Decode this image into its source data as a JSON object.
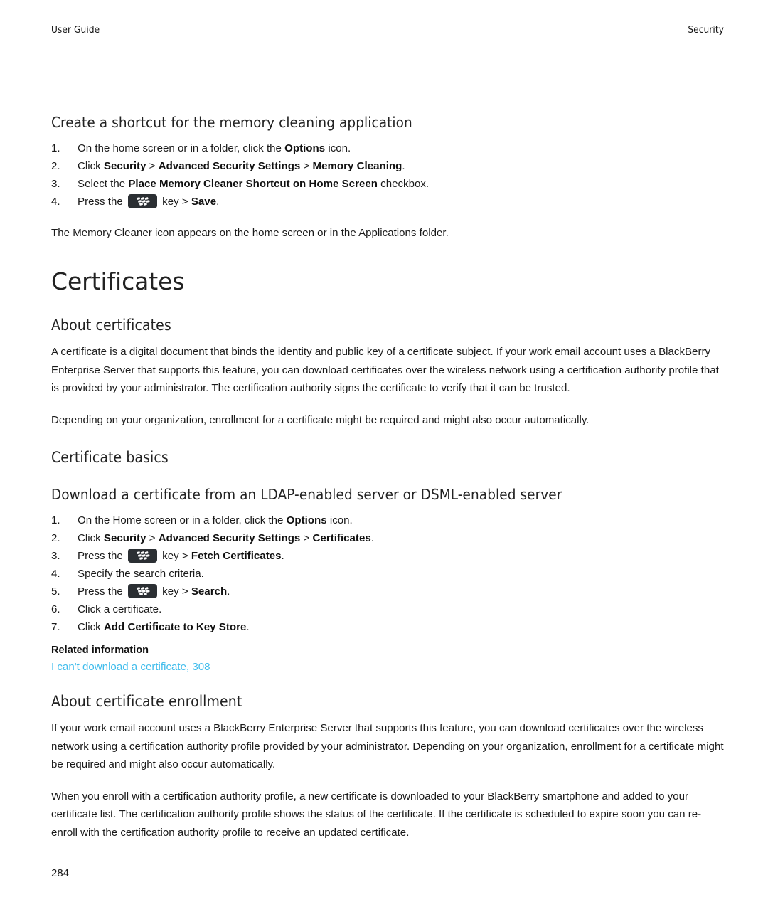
{
  "header": {
    "left": "User Guide",
    "right": "Security"
  },
  "colors": {
    "text": "#1a1a1a",
    "heading": "#222222",
    "link": "#41bdec",
    "menu_key_bg": "#2b2f33"
  },
  "icons": {
    "menu_key": "blackberry-menu-key-icon"
  },
  "task_memory_shortcut": {
    "heading": "Create a shortcut for the memory cleaning application",
    "steps": [
      {
        "parts": [
          {
            "t": "On the home screen or in a folder, click the ",
            "b": false
          },
          {
            "t": "Options",
            "b": true
          },
          {
            "t": " icon.",
            "b": false
          }
        ]
      },
      {
        "parts": [
          {
            "t": "Click ",
            "b": false
          },
          {
            "t": "Security",
            "b": true
          },
          {
            "t": " > ",
            "b": false
          },
          {
            "t": "Advanced Security Settings",
            "b": true
          },
          {
            "t": " > ",
            "b": false
          },
          {
            "t": "Memory Cleaning",
            "b": true
          },
          {
            "t": ".",
            "b": false
          }
        ]
      },
      {
        "parts": [
          {
            "t": "Select the ",
            "b": false
          },
          {
            "t": "Place Memory Cleaner Shortcut on Home Screen",
            "b": true
          },
          {
            "t": " checkbox.",
            "b": false
          }
        ]
      },
      {
        "parts": [
          {
            "t": "Press the ",
            "b": false
          },
          {
            "icon": "menu-key"
          },
          {
            "t": " key > ",
            "b": false
          },
          {
            "t": "Save",
            "b": true
          },
          {
            "t": ".",
            "b": false
          }
        ]
      }
    ],
    "result": "The Memory Cleaner icon appears on the home screen or in the Applications folder."
  },
  "chapter": {
    "title": "Certificates"
  },
  "about_certificates": {
    "heading": "About certificates",
    "paragraphs": [
      "A certificate is a digital document that binds the identity and public key of a certificate subject. If your work email account uses a BlackBerry Enterprise Server that supports this feature, you can download certificates over the wireless network using a certification authority profile that is provided by your administrator. The certification authority signs the certificate to verify that it can be trusted.",
      "Depending on your organization, enrollment for a certificate might be required and might also occur automatically."
    ]
  },
  "certificate_basics": {
    "heading": "Certificate basics"
  },
  "task_download_certificate": {
    "heading": "Download a certificate from an LDAP-enabled server or DSML-enabled server",
    "steps": [
      {
        "parts": [
          {
            "t": "On the Home screen or in a folder, click the ",
            "b": false
          },
          {
            "t": "Options",
            "b": true
          },
          {
            "t": " icon.",
            "b": false
          }
        ]
      },
      {
        "parts": [
          {
            "t": "Click ",
            "b": false
          },
          {
            "t": "Security",
            "b": true
          },
          {
            "t": " > ",
            "b": false
          },
          {
            "t": "Advanced Security Settings",
            "b": true
          },
          {
            "t": " > ",
            "b": false
          },
          {
            "t": "Certificates",
            "b": true
          },
          {
            "t": ".",
            "b": false
          }
        ]
      },
      {
        "parts": [
          {
            "t": "Press the ",
            "b": false
          },
          {
            "icon": "menu-key"
          },
          {
            "t": " key > ",
            "b": false
          },
          {
            "t": "Fetch Certificates",
            "b": true
          },
          {
            "t": ".",
            "b": false
          }
        ]
      },
      {
        "parts": [
          {
            "t": "Specify the search criteria.",
            "b": false
          }
        ]
      },
      {
        "parts": [
          {
            "t": "Press the ",
            "b": false
          },
          {
            "icon": "menu-key"
          },
          {
            "t": " key > ",
            "b": false
          },
          {
            "t": "Search",
            "b": true
          },
          {
            "t": ".",
            "b": false
          }
        ]
      },
      {
        "parts": [
          {
            "t": "Click a certificate.",
            "b": false
          }
        ]
      },
      {
        "parts": [
          {
            "t": "Click ",
            "b": false
          },
          {
            "t": "Add Certificate to Key Store",
            "b": true
          },
          {
            "t": ".",
            "b": false
          }
        ]
      }
    ],
    "related": {
      "title": "Related information",
      "links": [
        "I can't download a certificate, 308"
      ]
    }
  },
  "about_certificate_enrollment": {
    "heading": "About certificate enrollment",
    "paragraphs": [
      "If your work email account uses a BlackBerry Enterprise Server that supports this feature, you can download certificates over the wireless network using a certification authority profile provided by your administrator. Depending on your organization, enrollment for a certificate might be required and might also occur automatically.",
      "When you enroll with a certification authority profile, a new certificate is downloaded to your BlackBerry smartphone and added to your certificate list. The certification authority profile shows the status of the certificate. If the certificate is scheduled to expire soon you can re-enroll with the certification authority profile to receive an updated certificate."
    ]
  },
  "footer": {
    "page_number": "284"
  }
}
